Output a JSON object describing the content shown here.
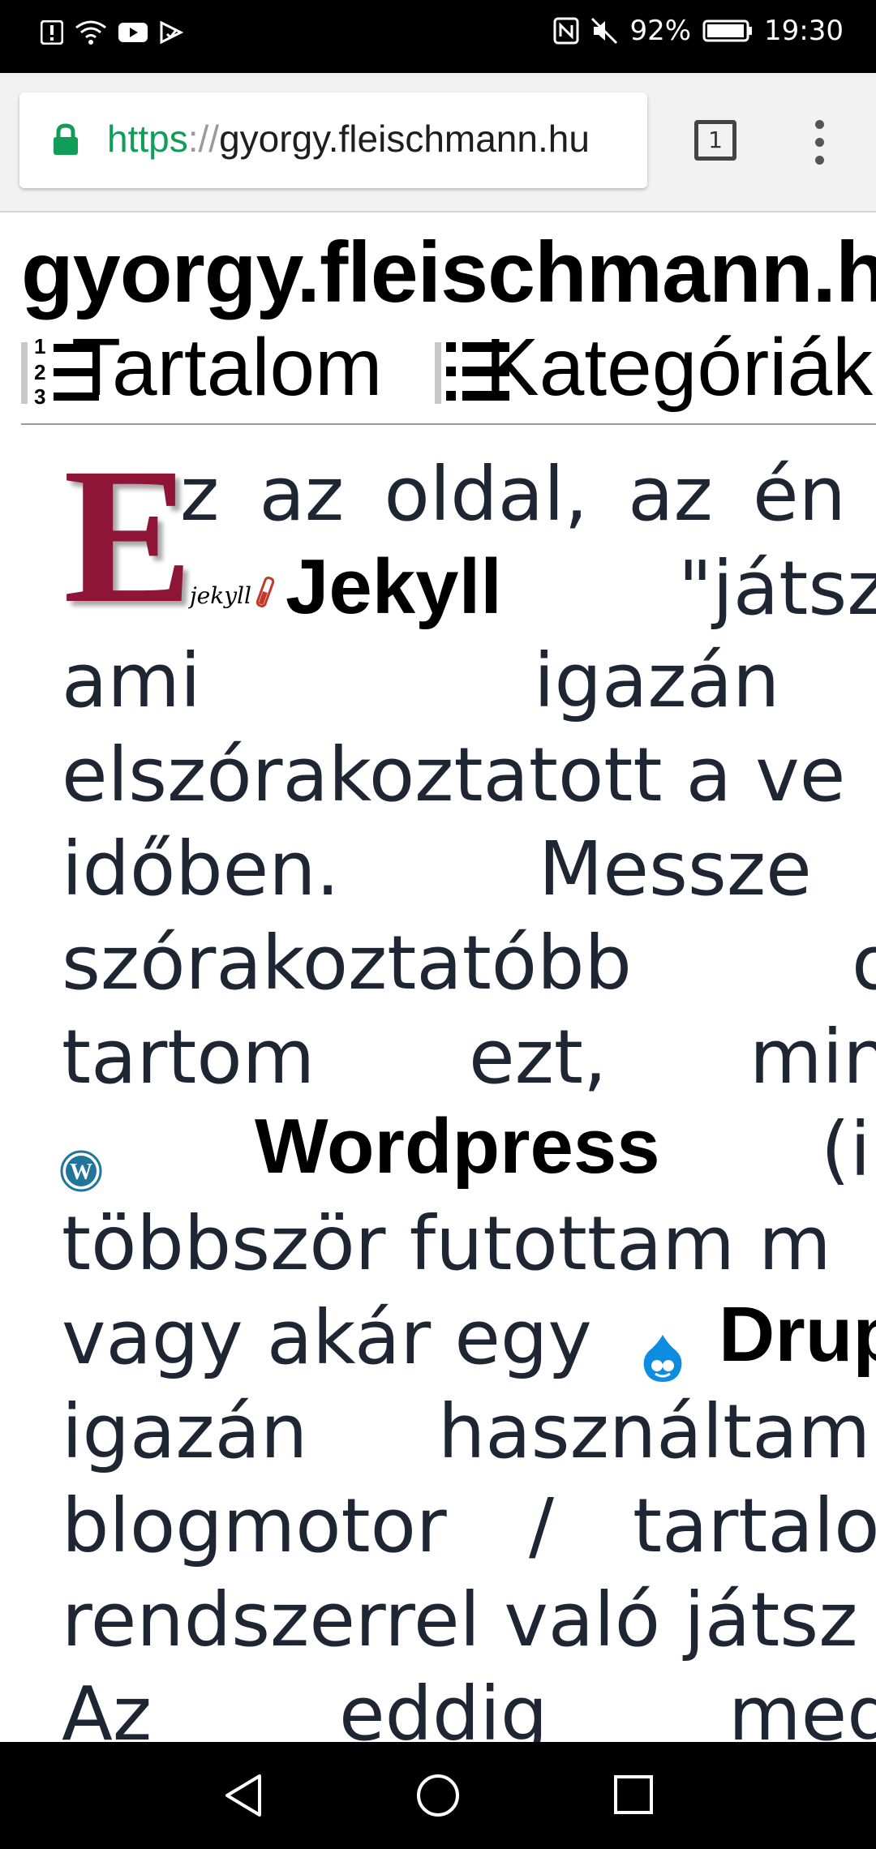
{
  "status_bar": {
    "battery": "92%",
    "time": "19:30"
  },
  "browser": {
    "url_scheme": "https",
    "url_sep": "://",
    "url_host": "gyorgy.fleischmann.hu",
    "tab_count": "1"
  },
  "page": {
    "site_title": "gyorgy.fleischmann.hu",
    "nav": [
      {
        "label": "Tartalom"
      },
      {
        "label": "Kategóriák"
      }
    ],
    "dropcap": "E",
    "lines": [
      "z az oldal, az én",
      "\"játsz",
      "ami",
      "igazán",
      "elszórakoztatott a ve",
      "időben.",
      "Messze",
      "szórakoztatóbb",
      "tartom",
      "ezt,",
      "min",
      "(i",
      "többször futottam m",
      "vagy akár egy",
      "igazán",
      "használtam",
      "blogmotor",
      "/",
      "tartalo",
      "rendszerrel való játsz",
      "Az",
      "eddig",
      "meg"
    ],
    "terms": {
      "jekyll": "Jekyll",
      "jekyll_logo": "jekyll",
      "wordpress": "Wordpress",
      "drupal": "Drup"
    }
  },
  "colors": {
    "dropcap": "#8e1538",
    "url_scheme": "#0f9d58",
    "body_text": "#1f2633"
  }
}
